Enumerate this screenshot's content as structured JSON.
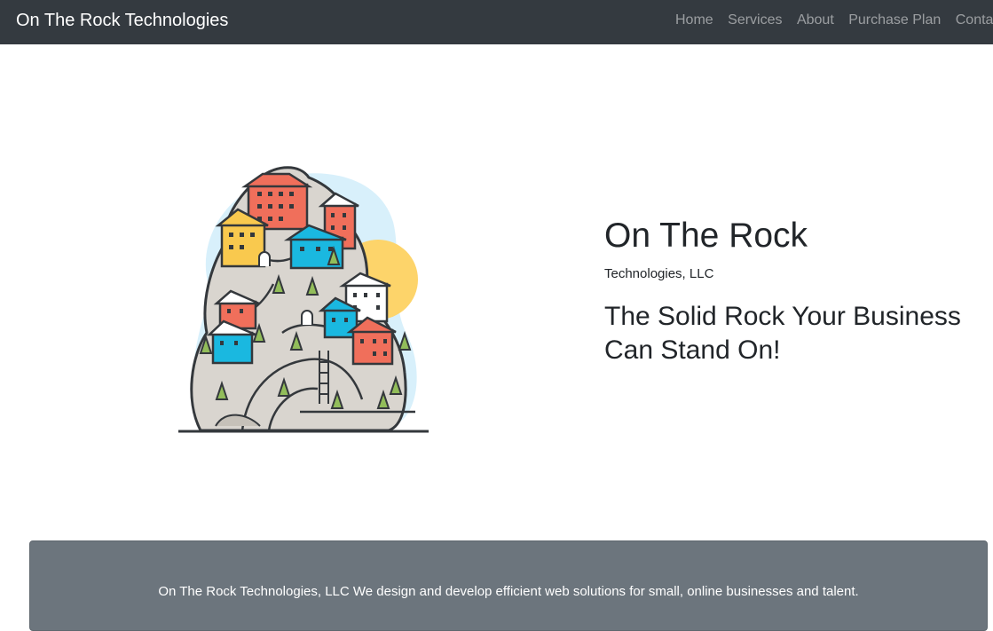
{
  "navbar": {
    "brand": "On The Rock Technologies",
    "links": [
      "Home",
      "Services",
      "About",
      "Purchase Plan",
      "Contact"
    ]
  },
  "hero": {
    "title": "On The Rock",
    "subtitle": "Technologies, LLC",
    "tagline": "The Solid Rock Your Business Can Stand On!",
    "illustration": "rock-city-illustration"
  },
  "footer": {
    "text": "On The Rock Technologies, LLC We design and develop efficient web solutions for small, online businesses and talent."
  },
  "colors": {
    "navbar_bg": "#343a40",
    "footer_bg": "#6c757d",
    "house_red": "#f06f5b",
    "house_blue": "#1ab8e0",
    "house_yellow": "#f9c94e",
    "rock": "#d9d5cf",
    "sky": "#d8f0fb",
    "sun": "#fdd46a",
    "tree": "#92bd5a"
  }
}
